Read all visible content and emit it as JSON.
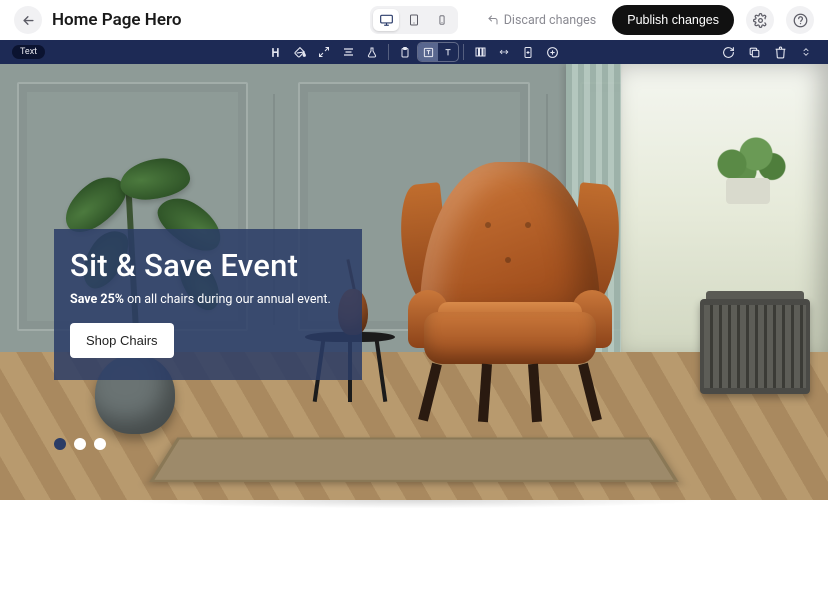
{
  "header": {
    "title": "Home Page Hero",
    "discard_label": "Discard changes",
    "publish_label": "Publish changes"
  },
  "toolbar": {
    "element_tag": "Text"
  },
  "hero": {
    "headline": "Sit & Save Event",
    "subline_bold": "Save 25%",
    "subline_rest": " on all chairs during our annual event.",
    "cta_label": "Shop Chairs",
    "active_slide": 1,
    "slide_count": 3
  },
  "colors": {
    "toolbar_bg": "#1d2a55",
    "overlay_bg": "rgba(42,60,102,.85)",
    "chair": "#c06d2e"
  }
}
